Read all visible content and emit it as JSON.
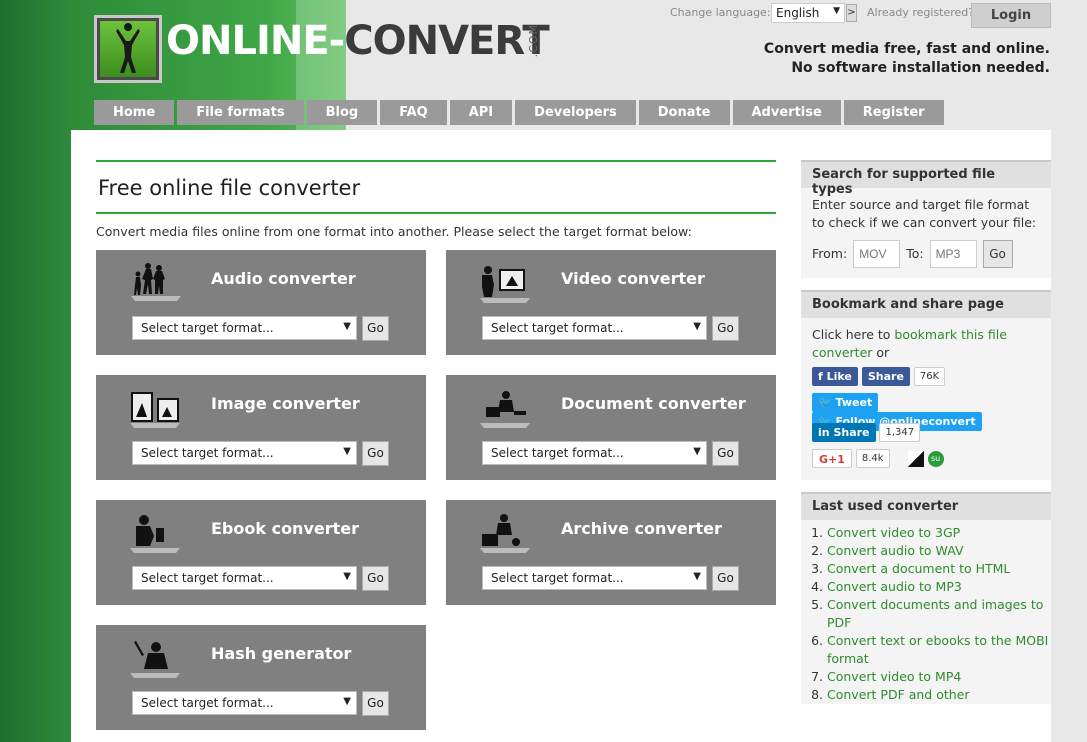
{
  "header": {
    "logo_main": "ONLINE-",
    "logo_dark": "CONVERT",
    "logo_com": ".COM",
    "change_language_label": "Change language:",
    "language_selected": "English",
    "language_go": ">",
    "already_registered_label": "Already registered?",
    "login_label": "Login",
    "tagline_line1": "Convert media free, fast and online.",
    "tagline_line2": "No software installation needed."
  },
  "nav": [
    "Home",
    "File formats",
    "Blog",
    "FAQ",
    "API",
    "Developers",
    "Donate",
    "Advertise",
    "Register"
  ],
  "main": {
    "title": "Free online file converter",
    "intro": "Convert media files online from one format into another. Please select the target format below:",
    "select_placeholder": "Select target format...",
    "go_label": "Go",
    "converters": [
      {
        "name": "Audio converter",
        "icon": "audio-people-icon"
      },
      {
        "name": "Video converter",
        "icon": "video-camera-icon"
      },
      {
        "name": "Image converter",
        "icon": "image-frame-icon"
      },
      {
        "name": "Document converter",
        "icon": "document-desk-icon"
      },
      {
        "name": "Ebook converter",
        "icon": "ebook-reader-icon"
      },
      {
        "name": "Archive converter",
        "icon": "archive-box-icon"
      },
      {
        "name": "Hash generator",
        "icon": "hash-figure-icon"
      }
    ]
  },
  "sidebar": {
    "search": {
      "title": "Search for supported file types",
      "text": "Enter source and target file format to check if we can convert your file:",
      "from_label": "From:",
      "from_placeholder": "MOV",
      "to_label": "To:",
      "to_placeholder": "MP3",
      "go_label": "Go"
    },
    "bookmark": {
      "title": "Bookmark and share page",
      "text_before": "Click here to ",
      "link": "bookmark this file converter",
      "text_after": " or",
      "fb_like": "Like",
      "fb_share": "Share",
      "fb_count": "76K",
      "tweet": "Tweet",
      "follow": "Follow @onlineconvert",
      "li_share": "Share",
      "li_count": "1,347",
      "gplus": "G+1",
      "gplus_count": "8.4k"
    },
    "last_used": {
      "title": "Last used converter",
      "items": [
        "Convert video to 3GP",
        "Convert audio to WAV",
        "Convert a document to HTML",
        "Convert audio to MP3",
        "Convert documents and images to PDF",
        "Convert text or ebooks to the MOBI format",
        "Convert video to MP4",
        "Convert PDF and other"
      ]
    }
  },
  "colors": {
    "accent_green": "#2fa63a",
    "link_green": "#2e8b2e",
    "panel_gray": "#808080",
    "nav_gray": "#9a9a9a"
  }
}
